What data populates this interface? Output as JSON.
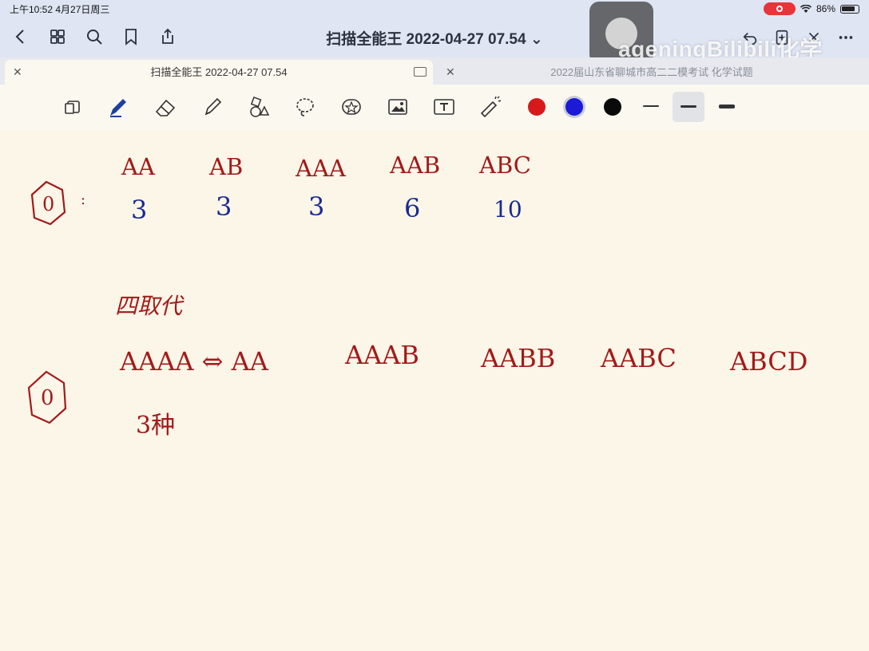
{
  "status": {
    "time": "上午10:52  4月27日周三",
    "battery": "86%"
  },
  "nav": {
    "title": "扫描全能王 2022-04-27 07.54",
    "watermark": "ageningBilibili化学"
  },
  "tabs": [
    {
      "label": "扫描全能王 2022-04-27 07.54"
    },
    {
      "label": "2022届山东省聊城市高二二模考试 化学试题"
    }
  ],
  "colors": {
    "red": "#d7191b",
    "blue": "#1a1ad7",
    "black": "#0a0a0a",
    "ink_red": "#a31a1a",
    "ink_blue": "#1a2a92"
  },
  "notes": {
    "row1": {
      "labels": [
        "AA",
        "AB",
        "AAA",
        "AAB",
        "ABC"
      ],
      "counts": [
        "3",
        "3",
        "3",
        "6",
        "10"
      ]
    },
    "heading": "四取代",
    "row2": {
      "labels": [
        "AAAA ⇔ AA",
        "AAAB",
        "AABB",
        "AABC",
        "ABCD"
      ],
      "note": "3种"
    },
    "ring_label": "0"
  }
}
